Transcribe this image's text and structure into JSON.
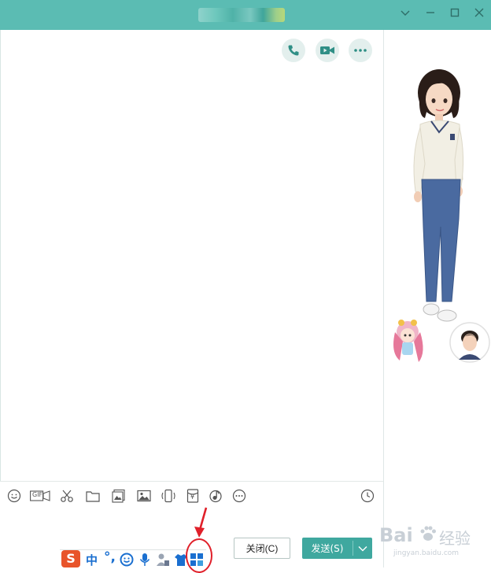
{
  "window": {
    "title_blurred": true,
    "controls": {
      "minimize": "—",
      "maximize": "□",
      "close": "✕",
      "dropdown": "⌄"
    },
    "accent_color": "#5bbcb3"
  },
  "header_actions": [
    {
      "name": "phone-call-button",
      "icon": "phone-icon"
    },
    {
      "name": "video-call-button",
      "icon": "video-camera-icon"
    },
    {
      "name": "more-options-button",
      "icon": "ellipsis-icon"
    }
  ],
  "toolbar": {
    "items": [
      "emoji-icon",
      "gif-icon",
      "scissors-icon",
      "folder-icon",
      "image-gallery-icon",
      "picture-icon",
      "shake-icon",
      "red-packet-icon",
      "music-icon",
      "more-icon"
    ],
    "gif_label": "GIF",
    "red_packet_symbol": "¥",
    "history_icon": "clock-icon"
  },
  "buttons": {
    "close_label": "关闭(C)",
    "send_label": "发送(S)",
    "send_dropdown": "⌄"
  },
  "ime_bar": {
    "logo": "S",
    "lang": "中",
    "punct": "°,"
  },
  "watermark": {
    "brand_left": "Bai",
    "brand_right": "经验",
    "url": "jingyan.baidu.com"
  }
}
